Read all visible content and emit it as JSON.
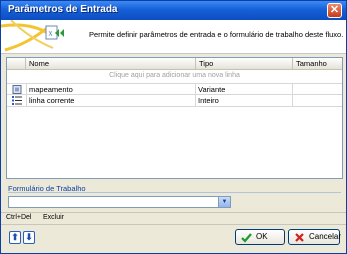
{
  "window": {
    "title": "Parâmetros de Entrada"
  },
  "banner": {
    "text": "Permite definir parâmetros de entrada e o formulário de trabalho deste fluxo."
  },
  "grid": {
    "columns": [
      "Nome",
      "Tipo",
      "Tamanho"
    ],
    "add_hint": "Clique aqui para adicionar uma nova linha",
    "rows": [
      {
        "name": "mapeamento",
        "type": "Variante",
        "size": "",
        "icon": "variant-icon"
      },
      {
        "name": "linha corrente",
        "type": "Inteiro",
        "size": "",
        "icon": "list-icon"
      }
    ]
  },
  "form": {
    "label": "Formulário de Trabalho",
    "value": ""
  },
  "status": {
    "shortcut": "Ctrl+Del",
    "action": "Excluir"
  },
  "buttons": {
    "ok": "OK",
    "cancel": "Cancelar"
  },
  "colors": {
    "title_bar": "#1660d8",
    "accent": "#0b3fa8",
    "ok_check": "#1a9c2a",
    "cancel_x": "#d02020"
  }
}
